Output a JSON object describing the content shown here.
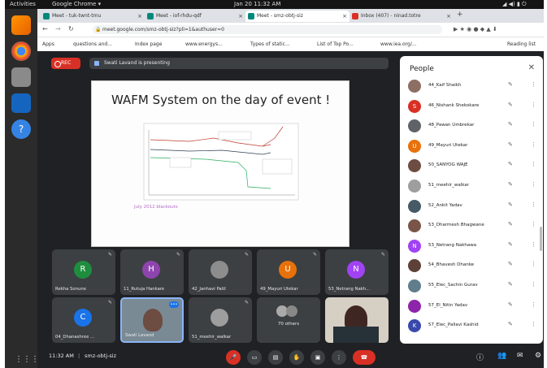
{
  "topbar": {
    "activities": "Activities",
    "app": "Google Chrome ▾",
    "clock": "Jan 20  11:32 AM"
  },
  "tabs": [
    {
      "label": "Meet - tuk-twnt-tmu",
      "fav": "#00897b"
    },
    {
      "label": "Meet - iof-rhdu-qdf",
      "fav": "#00897b"
    },
    {
      "label": "Meet - smz-obtj-siz",
      "fav": "#00897b"
    },
    {
      "label": "Inbox (407) - ninad.totre",
      "fav": "#d93025"
    }
  ],
  "url": "meet.google.com/smz-obtj-siz?pli=1&authuser=0",
  "bookmarks": [
    "Apps",
    "questions and...",
    "Index page",
    "www.energys...",
    "Types of static...",
    "List of Top Po...",
    "www.iea.org/...",
    "Reading list"
  ],
  "meet": {
    "rec": "REC",
    "presenting": "Swati Lavand is presenting",
    "slide": {
      "title": "WAFM System on the day of event !",
      "subtitle": "July 2012 blackouts"
    },
    "tiles": [
      {
        "name": "Rekha Sonune",
        "initial": "R",
        "color": "#1e8e3e"
      },
      {
        "name": "11_Rutuja Hankare",
        "initial": "H",
        "color": "#8e44ad"
      },
      {
        "name": "42_Janhavi Patil",
        "initial": "",
        "color": "#5f6368"
      },
      {
        "name": "49_Mayuri Utekar",
        "initial": "U",
        "color": "#e8710a"
      },
      {
        "name": "53_Netrang Nakh...",
        "initial": "N",
        "color": "#a142f4"
      },
      {
        "name": "04_Dhanashree ...",
        "initial": "C",
        "color": "#1a73e8"
      },
      {
        "name": "Swati Lavand",
        "initial": "",
        "color": "#5f6368"
      },
      {
        "name": "51_meehir_walkar",
        "initial": "",
        "color": "#5f6368"
      },
      {
        "name": "70 others",
        "initial": "",
        "color": "#5f6368"
      },
      {
        "name": "",
        "initial": "",
        "color": "#5f6368"
      }
    ]
  },
  "people": {
    "title": "People",
    "list": [
      {
        "name": "44_Kaif Shaikh",
        "initial": "",
        "color": "#8d6e63"
      },
      {
        "name": "46_Nishank Shekokare",
        "initial": "S",
        "color": "#d93025"
      },
      {
        "name": "48_Pawan Umbrekar",
        "initial": "",
        "color": "#5f6368"
      },
      {
        "name": "49_Mayuri Utekar",
        "initial": "U",
        "color": "#e8710a"
      },
      {
        "name": "50_SANYOG WAJE",
        "initial": "",
        "color": "#6d4c41"
      },
      {
        "name": "51_meehir_walkar",
        "initial": "",
        "color": "#9e9e9e"
      },
      {
        "name": "52_Ankit Yadav",
        "initial": "",
        "color": "#455a64"
      },
      {
        "name": "53_Dharmesh Bhagwane",
        "initial": "",
        "color": "#795548"
      },
      {
        "name": "53_Netrang Nakhawa",
        "initial": "N",
        "color": "#a142f4"
      },
      {
        "name": "54_Bhavesh Dhanke",
        "initial": "",
        "color": "#5d4037"
      },
      {
        "name": "55_Elec_Sachin Gurav",
        "initial": "",
        "color": "#607d8b"
      },
      {
        "name": "57_El_Nitin Yadav",
        "initial": "",
        "color": "#8e24aa"
      },
      {
        "name": "57_Elec_Pallavi Kashid",
        "initial": "K",
        "color": "#3949ab"
      }
    ]
  },
  "bottom": {
    "time": "11:32 AM",
    "code": "smz-obtj-siz"
  }
}
